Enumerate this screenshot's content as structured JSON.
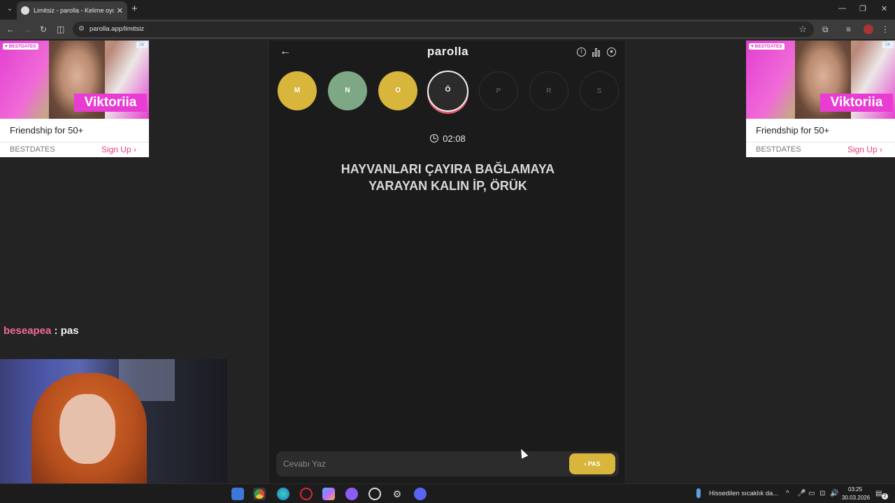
{
  "browser": {
    "tab_title": "Limitsiz - parolla - Kelime oyunu",
    "url": "parolla.app/limitsiz"
  },
  "ads": {
    "brand_badge": "♥ BESTDATES",
    "name": "Viktoriia",
    "tagline": "Friendship for 50+",
    "sponsor": "BESTDATES",
    "cta": "Sign Up"
  },
  "chat": {
    "user": "beseapea",
    "message": " : pas"
  },
  "game": {
    "logo": "parolla",
    "letters": [
      {
        "letter": "M",
        "state": "correct-yellow"
      },
      {
        "letter": "N",
        "state": "correct-green"
      },
      {
        "letter": "O",
        "state": "correct-yellow"
      },
      {
        "letter": "Ö",
        "state": "active"
      },
      {
        "letter": "P",
        "state": "empty"
      },
      {
        "letter": "R",
        "state": "empty"
      },
      {
        "letter": "S",
        "state": "empty"
      }
    ],
    "timer": "02:08",
    "question_line1": "HAYVANLARI ÇAYIRA BAĞLAMAYA",
    "question_line2": "YARAYAN KALIN İP, ÖRÜK",
    "answer_placeholder": "Cevabı Yaz",
    "pas_label": "PAS",
    "colors": {
      "yellow": "#d8b53b",
      "green": "#7ea885",
      "active_ring": "#e05a6a"
    }
  },
  "taskbar": {
    "weather": "Hissedilen sıcaklık da...",
    "time": "03:25",
    "date": "30.03.2026",
    "notifications": "2"
  }
}
